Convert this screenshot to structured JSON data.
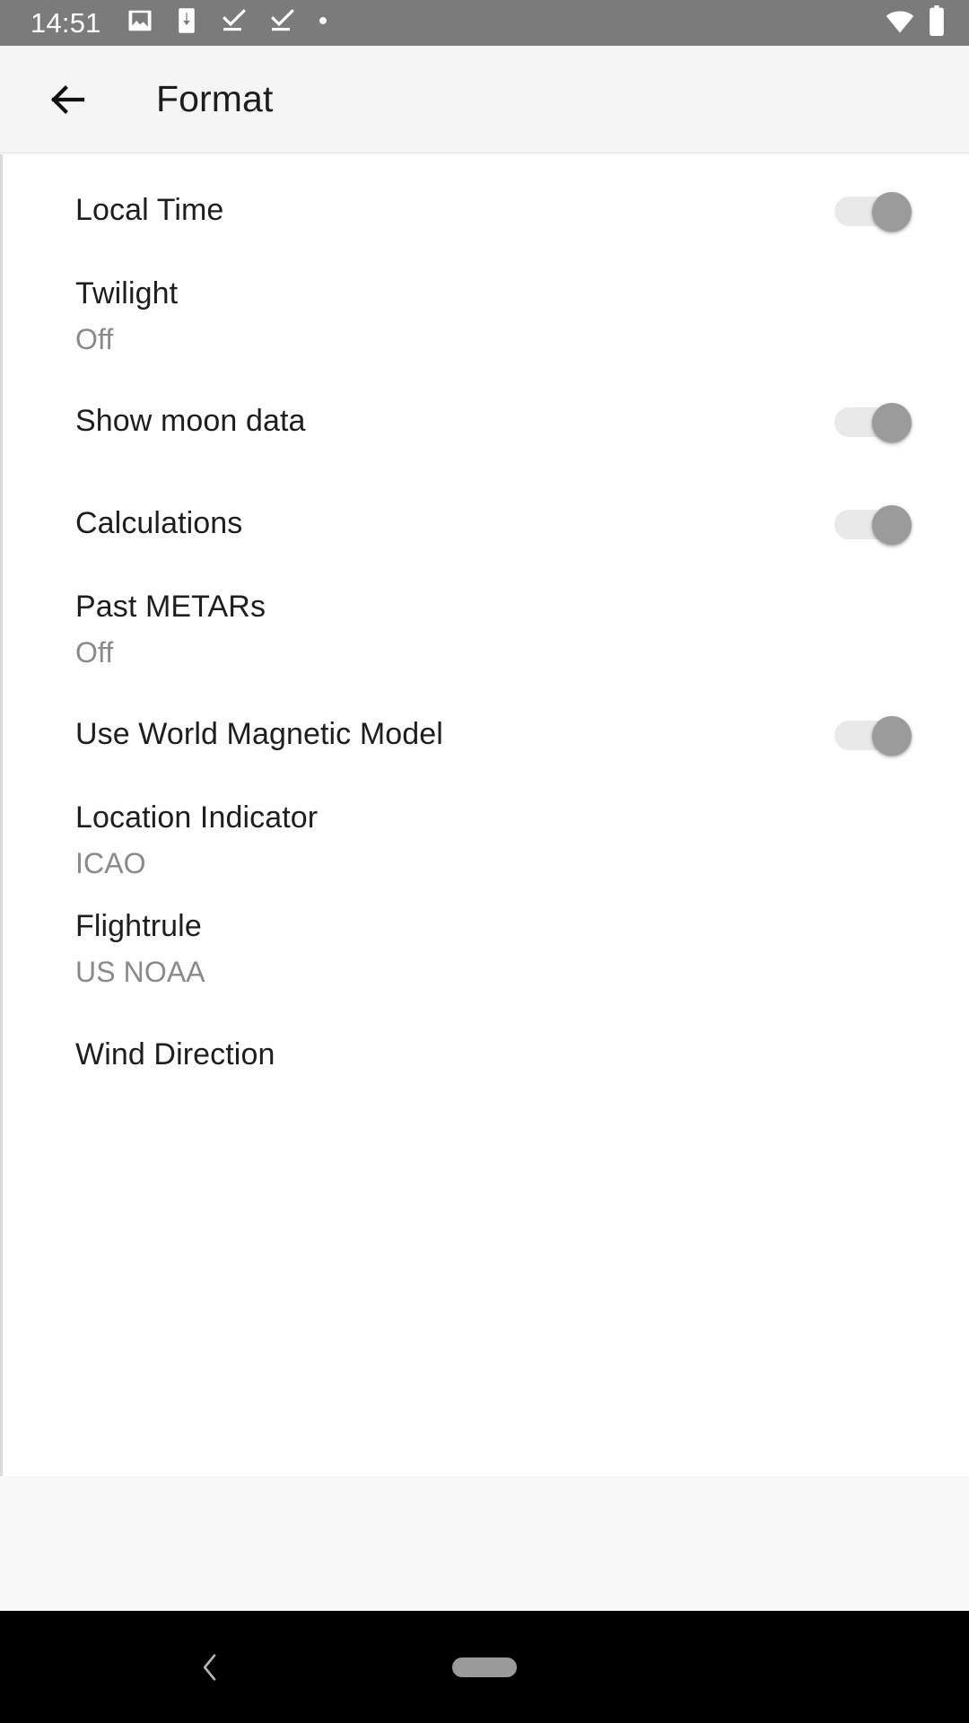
{
  "status_bar": {
    "time": "14:51",
    "left_icons": [
      "image-icon",
      "download-to-phone-icon",
      "task-complete-icon",
      "task-complete-icon",
      "dot-icon"
    ],
    "right_icons": [
      "wifi-icon",
      "battery-icon"
    ],
    "background_color": "#7b7b7b",
    "icon_color": "#ffffff"
  },
  "app_bar": {
    "back_icon": "back-arrow-icon",
    "title": "Format",
    "background_color": "#f5f5f5",
    "title_color": "#1d1d1d"
  },
  "settings": {
    "rows": [
      {
        "title": "Local Time",
        "subtitle": "",
        "control": "switch",
        "switch_on": true
      },
      {
        "title": "Twilight",
        "subtitle": "Off",
        "control": "none",
        "switch_on": null
      },
      {
        "title": "Show moon data",
        "subtitle": "",
        "control": "switch",
        "switch_on": true
      },
      {
        "title": "Calculations",
        "subtitle": "",
        "control": "switch",
        "switch_on": true
      },
      {
        "title": "Past METARs",
        "subtitle": "Off",
        "control": "none",
        "switch_on": null
      },
      {
        "title": "Use World Magnetic Model",
        "subtitle": "",
        "control": "switch",
        "switch_on": true
      },
      {
        "title": "Location Indicator",
        "subtitle": "ICAO",
        "control": "none",
        "switch_on": null
      },
      {
        "title": "Flightrule",
        "subtitle": "US NOAA",
        "control": "none",
        "switch_on": null
      },
      {
        "title": "Wind Direction",
        "subtitle": "",
        "control": "none",
        "switch_on": null
      }
    ],
    "switch_track_color": "#e9e9e9",
    "switch_thumb_color": "#9b9b9b",
    "title_color": "#1e1e1e",
    "subtitle_color": "#8a8a8a"
  },
  "nav_bar": {
    "back_icon": "nav-back-chevron-icon",
    "home_indicator": "home-pill-indicator",
    "background_color": "#000000",
    "indicator_color": "#9a9a9a"
  }
}
